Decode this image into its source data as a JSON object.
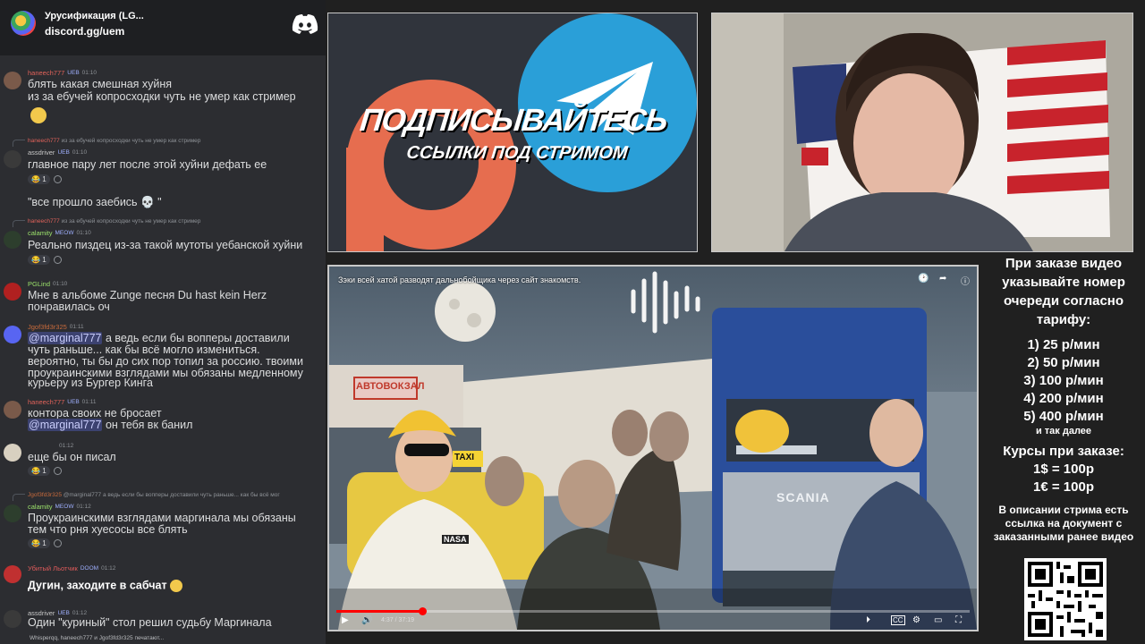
{
  "discord": {
    "server_name": "Урусификация (LG...",
    "invite": "discord.gg/uem"
  },
  "messages": [
    {
      "user": "haneech777",
      "badge": "UEB",
      "time": "01:10",
      "lines": [
        "блять какая смешная хуйня",
        "из за ебучей копросходки чуть не умер как стример"
      ]
    },
    {
      "reply_user": "haneech777",
      "reply_text": "из за ебучей копросходки чуть не умер как стример",
      "user": "assdriver",
      "badge": "UEB",
      "time": "01:10",
      "lines": [
        "главное пару лет после этой хуйни дефать ее"
      ],
      "react_count": "1",
      "extra": "\"все прошло заебись"
    },
    {
      "reply_user": "haneech777",
      "reply_text": "из за ебучей копросходки чуть не умер как стример",
      "user": "calamity",
      "badge": "MEOW",
      "time": "01:10",
      "lines": [
        "Реально пиздец из-за такой мутоты уебанской хуйни"
      ],
      "react_count": "1"
    },
    {
      "user": "PGLind",
      "time": "01:10",
      "lines": [
        "Мне в альбоме Zunge песня Du hast kein Herz",
        "понравилась оч"
      ]
    },
    {
      "user": "Jgof3fd3r325",
      "time": "01:11",
      "mention": "@marginal777",
      "lines": [
        " а ведь если бы вопперы доставили",
        "чуть раньше... как бы всё могло измениться.",
        "вероятно, ты бы до сих пор топил за россию. твоими",
        "проукраинскими взглядами мы обязаны медленному",
        "курьеру из Бургер Кинга"
      ]
    },
    {
      "user": "haneech777",
      "badge": "UEB",
      "time": "01:11",
      "lines": [
        "контора своих не бросает"
      ],
      "mention2": "@marginal777",
      "line2": " он тебя вк банил"
    },
    {
      "time": "01:12",
      "lines": [
        "еще бы он писал"
      ],
      "react_count": "1"
    },
    {
      "reply_user": "Jgof3fd3r325",
      "reply_text": "@marginal777 а ведь если бы вопперы доставили чуть раньше... как бы всё мог",
      "user": "calamity",
      "badge": "MEOW",
      "time": "01:12",
      "lines": [
        "Проукраинскими взглядами маргинала мы обязаны",
        "тем что рня хуесосы все блять"
      ],
      "react_count": "1"
    },
    {
      "user": "Убитый Льотчик",
      "badge": "DOOM",
      "time": "01:12",
      "lines": [
        "Дугин, заходите в сабчат"
      ]
    },
    {
      "user": "assdriver",
      "badge": "UEB",
      "time": "01:12",
      "lines": [
        "Один \"куриный\" стол решил судьбу Маргинала"
      ]
    }
  ],
  "typing": "Whisperqq, haneech777 и Jgof3fd3r325 печатают...",
  "promo": {
    "title": "ПОДПИСЫВАЙТЕСЬ",
    "subtitle": "ССЫЛКИ ПОД СТРИМОМ"
  },
  "video": {
    "title": "Зэки всей хатой разводят дальнобойщика через сайт знакомств.",
    "time": "4:37 / 37:19",
    "progress": 0.136,
    "sign_bus": "АВТОВОКЗАЛ",
    "sign_taxi": "TAXI",
    "truck_brand": "SCANIA",
    "nasa": "NASA"
  },
  "info": {
    "intro": "При заказе видео указывайте номер очереди согласно тарифу:",
    "tariffs": [
      "1) 25 р/мин",
      "2) 50 р/мин",
      "3) 100 р/мин",
      "4) 200 р/мин",
      "5) 400 р/мин"
    ],
    "etc": "и так далее",
    "rates_title": "Курсы при заказе:",
    "rates": [
      "1$ = 100р",
      "1€ = 100р"
    ],
    "desc": "В описании стрима есть ссылка на документ с заказанными ранее видео"
  },
  "colors": {
    "discord_bg": "#2c2d31",
    "youtube_red": "#ff0000",
    "telegram_blue": "#2a9fd8",
    "patreon_orange": "#e66d4f"
  }
}
